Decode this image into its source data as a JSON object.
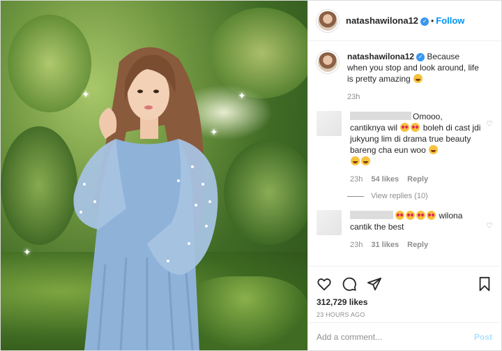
{
  "post": {
    "username": "natashawilona12",
    "follow_label": "Follow",
    "caption": "Because when you stop and look around, life is pretty amazing",
    "caption_time": "23h",
    "likes": "312,729 likes",
    "posted_ago": "23 HOURS AGO"
  },
  "comments": [
    {
      "text_line1": "Omooo,",
      "text_rest": "cantiknya wil",
      "text_mid": "boleh di cast jdi jukyung lim di drama true beauty bareng cha eun woo",
      "time": "23h",
      "likes": "54 likes",
      "reply_label": "Reply",
      "view_replies": "View replies (10)"
    },
    {
      "text_after_emoji": "wilona",
      "text_line2": "cantik the best",
      "time": "23h",
      "likes": "31 likes",
      "reply_label": "Reply"
    }
  ],
  "add_comment": {
    "placeholder": "Add a comment...",
    "post_label": "Post"
  },
  "icons": [
    "heart-icon",
    "comment-icon",
    "share-icon",
    "bookmark-icon",
    "verified-badge-icon"
  ],
  "colors": {
    "link": "#0095f6",
    "verified": "#3897f0",
    "muted": "#8e8e8e",
    "post_disabled": "#b2dffc"
  }
}
